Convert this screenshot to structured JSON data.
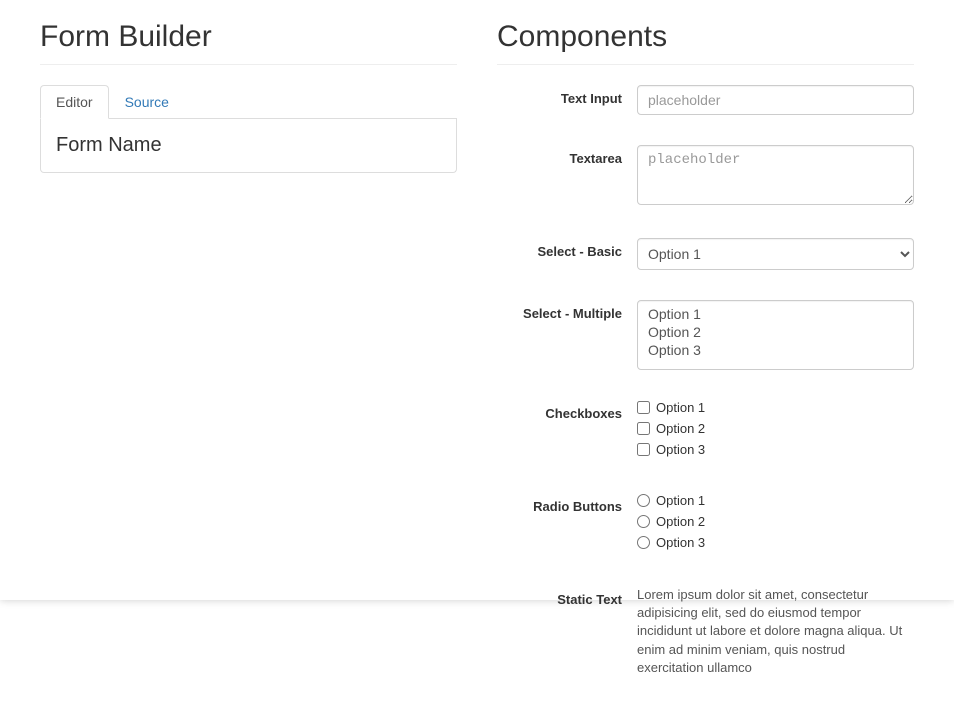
{
  "left": {
    "title": "Form Builder",
    "tabs": {
      "editor": "Editor",
      "source": "Source"
    },
    "form_name": "Form Name"
  },
  "right": {
    "title": "Components",
    "text_input": {
      "label": "Text Input",
      "placeholder": "placeholder"
    },
    "textarea": {
      "label": "Textarea",
      "placeholder": "placeholder"
    },
    "select_basic": {
      "label": "Select - Basic",
      "option1": "Option 1"
    },
    "select_multiple": {
      "label": "Select - Multiple",
      "option1": "Option 1",
      "option2": "Option 2",
      "option3": "Option 3"
    },
    "checkboxes": {
      "label": "Checkboxes",
      "option1": "Option 1",
      "option2": "Option 2",
      "option3": "Option 3"
    },
    "radios": {
      "label": "Radio Buttons",
      "option1": "Option 1",
      "option2": "Option 2",
      "option3": "Option 3"
    },
    "static_text": {
      "label": "Static Text",
      "value": "Lorem ipsum dolor sit amet, consectetur adipisicing elit, sed do eiusmod tempor incididunt ut labore et dolore magna aliqua. Ut enim ad minim veniam, quis nostrud exercitation ullamco"
    }
  }
}
